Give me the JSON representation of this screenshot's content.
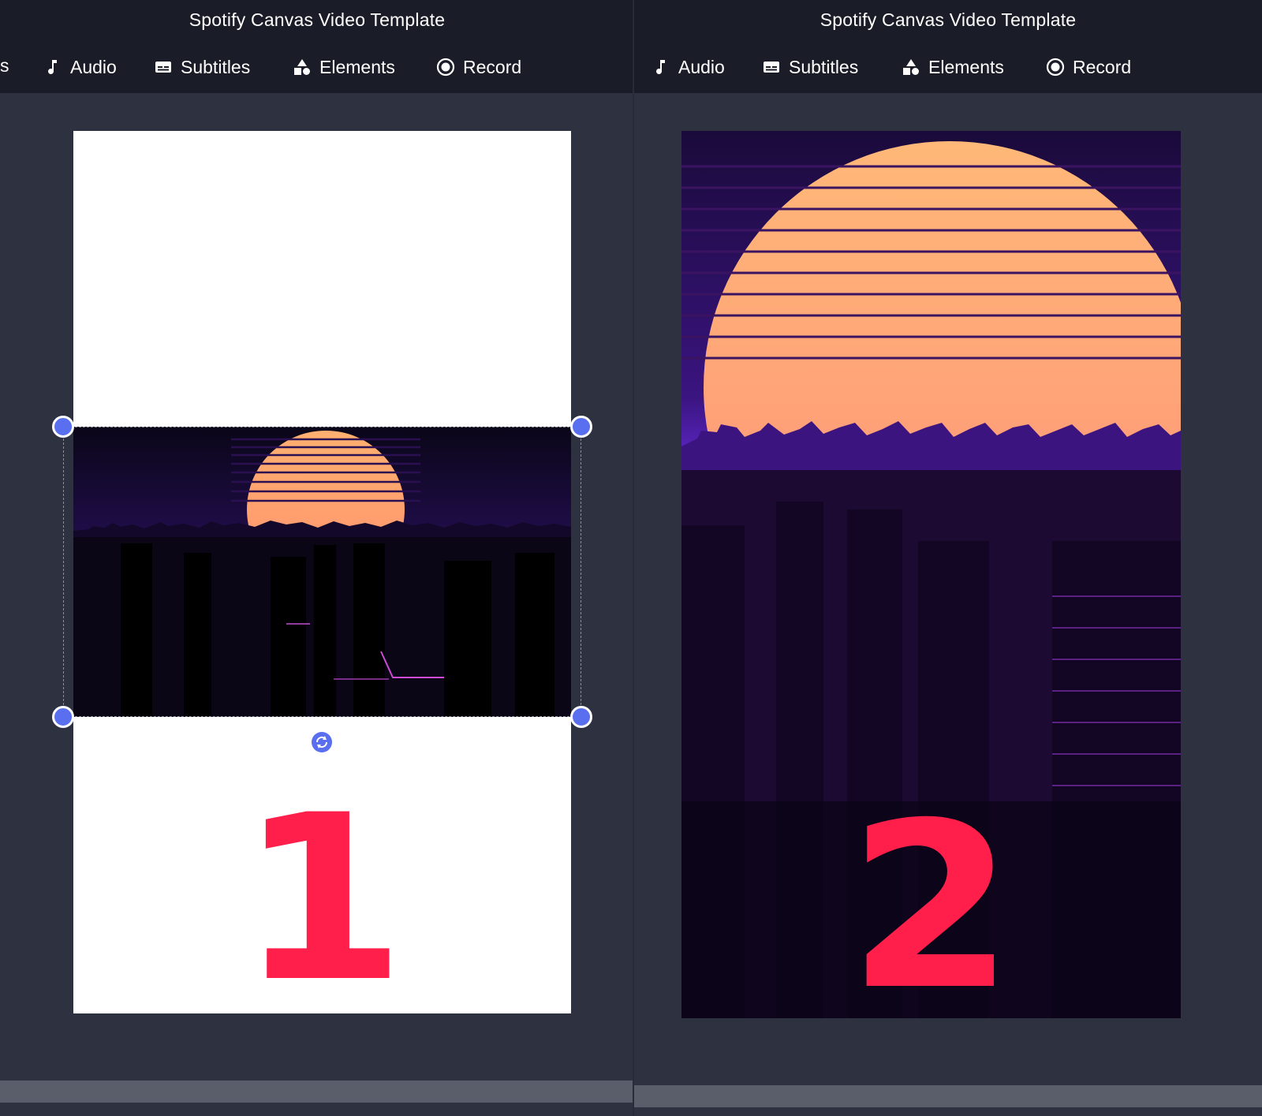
{
  "panels": [
    {
      "title": "Spotify Canvas Video Template",
      "partial_tool_label": "s",
      "tools": [
        {
          "label": "Audio",
          "icon": "music-note-icon"
        },
        {
          "label": "Subtitles",
          "icon": "subtitles-icon"
        },
        {
          "label": "Elements",
          "icon": "shapes-icon"
        },
        {
          "label": "Record",
          "icon": "record-icon"
        }
      ],
      "step_number": "1"
    },
    {
      "title": "Spotify Canvas Video Template",
      "tools": [
        {
          "label": "Audio",
          "icon": "music-note-icon"
        },
        {
          "label": "Subtitles",
          "icon": "subtitles-icon"
        },
        {
          "label": "Elements",
          "icon": "shapes-icon"
        },
        {
          "label": "Record",
          "icon": "record-icon"
        }
      ],
      "step_number": "2"
    }
  ],
  "colors": {
    "topbar": "#1a1d27",
    "workspace": "#2e3240",
    "accent_handle": "#5a6ff0",
    "number": "#ff1f4a"
  }
}
